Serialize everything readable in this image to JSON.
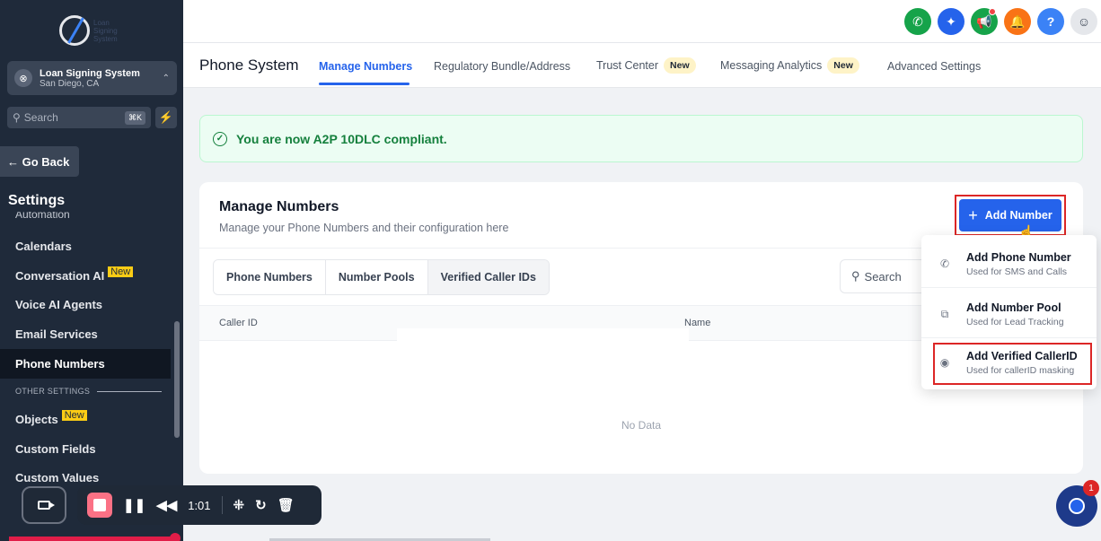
{
  "account": {
    "name": "Loan Signing System",
    "location": "San Diego, CA",
    "avatar_label": "⊗"
  },
  "logo": {
    "text": "Loan Signing System"
  },
  "sidebar": {
    "search_label": "Search",
    "search_shortcut": "⌘K",
    "go_back": "← Go Back",
    "settings_title": "Settings",
    "clipped_item": "Automation",
    "items": [
      {
        "label": "Calendars",
        "badge": ""
      },
      {
        "label": "Conversation AI",
        "badge": "New"
      },
      {
        "label": "Voice AI Agents",
        "badge": ""
      },
      {
        "label": "Email Services",
        "badge": ""
      },
      {
        "label": "Phone Numbers",
        "badge": "",
        "active": true
      }
    ],
    "other_settings_label": "OTHER SETTINGS",
    "other_items": [
      {
        "label": "Objects",
        "badge": "New"
      },
      {
        "label": "Custom Fields",
        "badge": ""
      },
      {
        "label": "Custom Values",
        "badge": ""
      }
    ]
  },
  "subnav": {
    "title": "Phone System",
    "tabs": [
      {
        "label": "Manage Numbers",
        "badge": ""
      },
      {
        "label": "Regulatory Bundle/Address",
        "badge": ""
      },
      {
        "label": "Trust Center",
        "badge": "New"
      },
      {
        "label": "Messaging Analytics",
        "badge": "New"
      },
      {
        "label": "Advanced Settings",
        "badge": ""
      }
    ]
  },
  "banner": {
    "message": "You are now A2P 10DLC compliant."
  },
  "card": {
    "title": "Manage Numbers",
    "subtitle": "Manage your Phone Numbers and their configuration here",
    "add_button": "Add Number",
    "tabs": [
      "Phone Numbers",
      "Number Pools",
      "Verified Caller IDs"
    ],
    "search_placeholder": "Search",
    "columns": [
      "Caller ID",
      "Name"
    ],
    "empty_text": "No Data"
  },
  "dropdown": [
    {
      "title": "Add Phone Number",
      "subtitle": "Used for SMS and Calls"
    },
    {
      "title": "Add Number Pool",
      "subtitle": "Used for Lead Tracking"
    },
    {
      "title": "Add Verified CallerID",
      "subtitle": "Used for callerID masking"
    }
  ],
  "recorder": {
    "time": "1:01"
  },
  "chat": {
    "badge": "1"
  },
  "colors": {
    "accent": "#2563eb",
    "sidebar": "#1f2a3a",
    "success": "#15803d",
    "highlight": "#dc2626"
  }
}
